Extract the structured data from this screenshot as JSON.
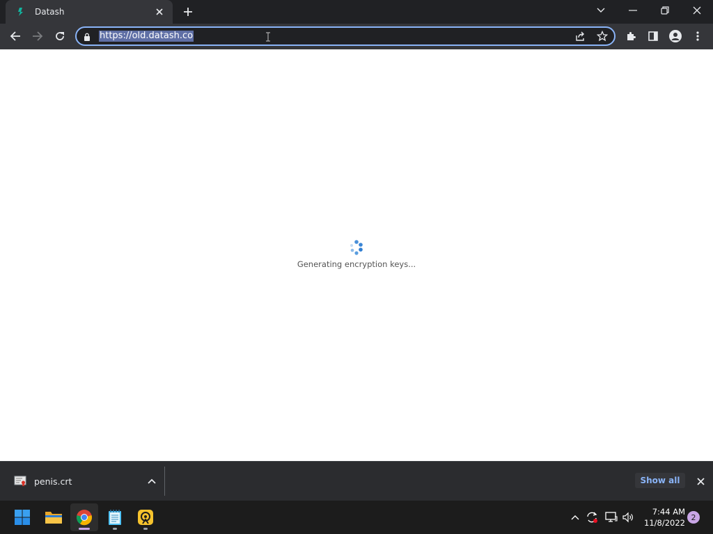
{
  "browser": {
    "tab": {
      "title": "Datash",
      "favicon": "datash-logo-icon"
    },
    "address_bar": {
      "url": "https://old.datash.co"
    },
    "toolbar_icons": [
      "back-icon",
      "forward-icon",
      "reload-icon",
      "lock-icon",
      "share-icon",
      "star-icon",
      "extensions-icon",
      "side-panel-icon",
      "profile-icon",
      "menu-icon"
    ]
  },
  "content": {
    "status_text": "Generating encryption keys..."
  },
  "download_shelf": {
    "file_name": "penis.crt",
    "show_all_label": "Show all"
  },
  "taskbar": {
    "apps": [
      "start",
      "file-explorer",
      "chrome",
      "notepad",
      "remote-app"
    ],
    "time": "7:44 AM",
    "date": "11/8/2022",
    "notification_count": "2"
  }
}
